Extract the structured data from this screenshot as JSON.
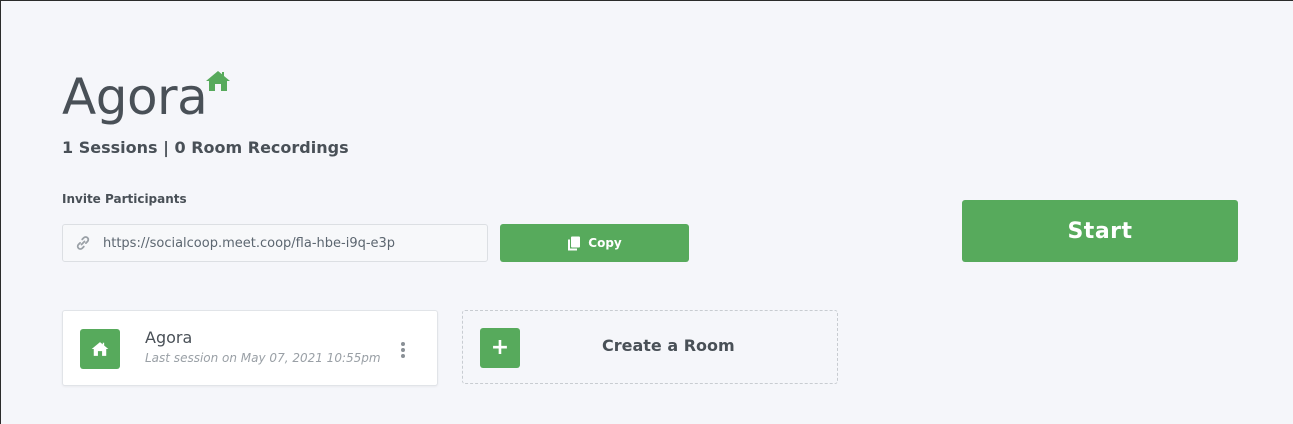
{
  "room": {
    "title": "Agora",
    "stats": "1 Sessions | 0 Room Recordings"
  },
  "invite": {
    "label": "Invite Participants",
    "url": "https://socialcoop.meet.coop/fla-hbe-i9q-e3p",
    "copy_label": "Copy"
  },
  "actions": {
    "start_label": "Start"
  },
  "rooms_list": {
    "items": [
      {
        "name": "Agora",
        "last_session": "Last session on May 07, 2021 10:55pm"
      }
    ],
    "create_label": "Create a Room",
    "create_symbol": "+"
  },
  "colors": {
    "accent": "#57aa5c",
    "text": "#495057",
    "background": "#f5f6fa"
  },
  "icons": {
    "title_icon": "home-icon",
    "invite_icon": "link-icon",
    "copy_icon": "copy-icon",
    "card_icon": "home-icon",
    "menu_icon": "vertical-ellipsis-icon"
  }
}
